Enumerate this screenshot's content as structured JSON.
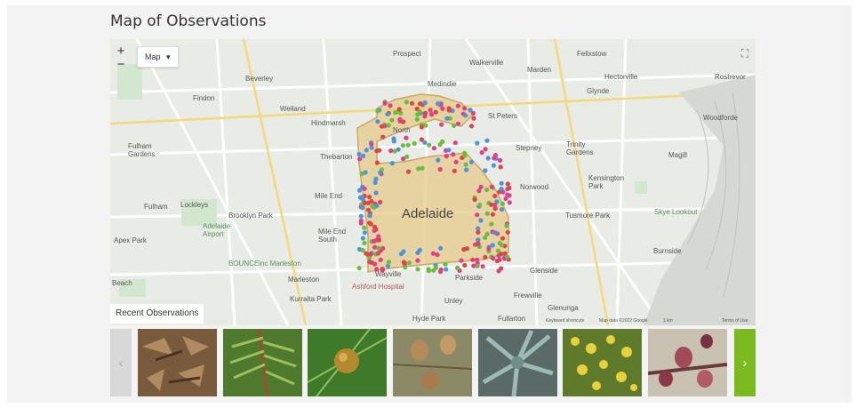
{
  "title": "Map of Observations",
  "map": {
    "zoom_in": "+",
    "zoom_out": "−",
    "map_type": "Map",
    "dropdown_arrow": "▾",
    "fullscreen_icon": "⛶",
    "labels": {
      "prospect": "Prospect",
      "walkerville": "Walkerville",
      "marden": "Marden",
      "felixstow": "Felixstow",
      "hectorville": "Hectorville",
      "rostrevor": "Rostrevor",
      "beverley": "Beverley",
      "medindie": "Medindie",
      "findon": "Findon",
      "welland": "Welland",
      "hindmarsh": "Hindmarsh",
      "st_peters": "St Peters",
      "glynde": "Glynde",
      "woodforde": "Woodforde",
      "fulham_gardens": "Fulham\nGardens",
      "north": "North",
      "stepney": "Stepney",
      "trinity_gardens": "Trinity\nGardens",
      "magill": "Magill",
      "thebarton": "Thebarton",
      "norwood": "Norwood",
      "kensington_park": "Kensington\nPark",
      "mile_end": "Mile End",
      "fulham": "Fulham",
      "lockleys": "Lockleys",
      "brooklyn_park": "Brooklyn Park",
      "adelaide": "Adelaide",
      "tusmore_park": "Tusmore Park",
      "mile_end_south": "Mile End\nSouth",
      "apex_park": "Apex Park",
      "burnside": "Burnside",
      "glenside": "Glenside",
      "marleston": "Marleston",
      "wayville": "Wayville",
      "parkside": "Parkside",
      "frewville": "Frewville",
      "kurralta_park": "Kurralta Park",
      "unley": "Unley",
      "glenunga": "Glenunga",
      "beach": "Beach",
      "adelaide_airport": "Adelaide\nAirport",
      "bounce": "BOUNCEinc Marleston",
      "ashford": "Ashford Hospital",
      "skye_lookout": "Skye Lookout",
      "hyde_park": "Hyde Park",
      "fullarton": "Fullarton"
    },
    "attribution": {
      "shortcuts": "Keyboard shortcuts",
      "map_data": "Map data ©2022 Google",
      "scale": "1 km",
      "terms": "Terms of Use"
    }
  },
  "recent": {
    "label": "Recent Observations",
    "prev_arrow": "‹",
    "next_arrow": "›"
  },
  "colors": {
    "accent": "#7cbb20",
    "boundary": "#d9b66a",
    "marker_pink": "#e0408a",
    "marker_blue": "#4a95e0",
    "marker_green": "#6abf3a",
    "marker_red": "#e04545"
  }
}
